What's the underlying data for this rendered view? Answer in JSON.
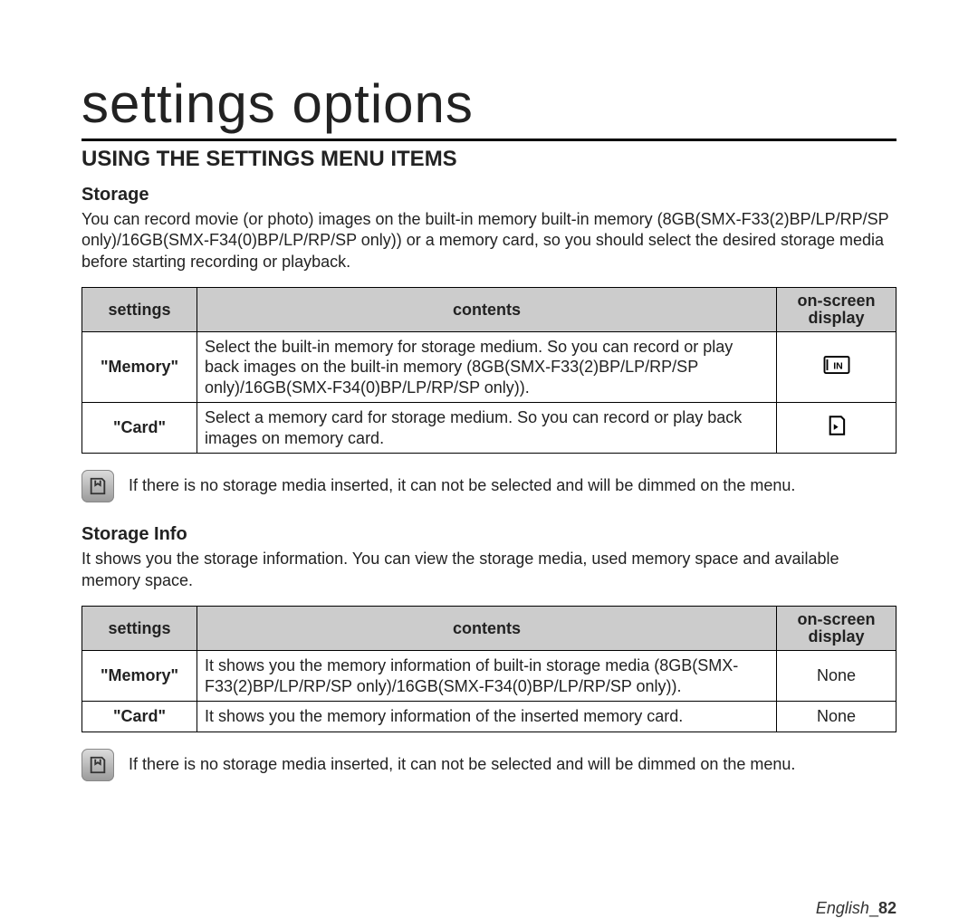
{
  "title": "settings options",
  "section_heading": "USING THE SETTINGS MENU ITEMS",
  "storage": {
    "heading": "Storage",
    "description": "You can record movie (or photo) images on the built-in memory built-in memory (8GB(SMX-F33(2)BP/LP/RP/SP only)/16GB(SMX-F34(0)BP/LP/RP/SP only)) or a memory card, so you should select the desired storage media before starting recording or playback.",
    "table": {
      "headers": {
        "settings": "settings",
        "contents": "contents",
        "osd": "on-screen display"
      },
      "rows": [
        {
          "setting": "\"Memory\"",
          "contents": "Select the built-in memory for storage medium. So you can record or play back images on the built-in memory (8GB(SMX-F33(2)BP/LP/RP/SP only)/16GB(SMX-F34(0)BP/LP/RP/SP only)).",
          "osd_icon": "memory-in-icon"
        },
        {
          "setting": "\"Card\"",
          "contents": "Select a memory card for storage medium. So you can record or play back images on memory card.",
          "osd_icon": "sd-card-icon"
        }
      ]
    },
    "note": "If there is no storage media inserted, it can not be selected and will be dimmed on the menu."
  },
  "storage_info": {
    "heading": "Storage Info",
    "description": "It shows you the storage information. You can view the storage media, used memory space and available memory space.",
    "table": {
      "headers": {
        "settings": "settings",
        "contents": "contents",
        "osd": "on-screen display"
      },
      "rows": [
        {
          "setting": "\"Memory\"",
          "contents": "It shows you the memory information of built-in storage media (8GB(SMX-F33(2)BP/LP/RP/SP only)/16GB(SMX-F34(0)BP/LP/RP/SP only)).",
          "osd_text": "None"
        },
        {
          "setting": "\"Card\"",
          "contents": "It shows you the memory information of the inserted memory card.",
          "osd_text": "None"
        }
      ]
    },
    "note": "If there is no storage media inserted, it can not be selected and will be dimmed on the menu."
  },
  "footer": {
    "language": "English",
    "sep": "_",
    "page": "82"
  }
}
